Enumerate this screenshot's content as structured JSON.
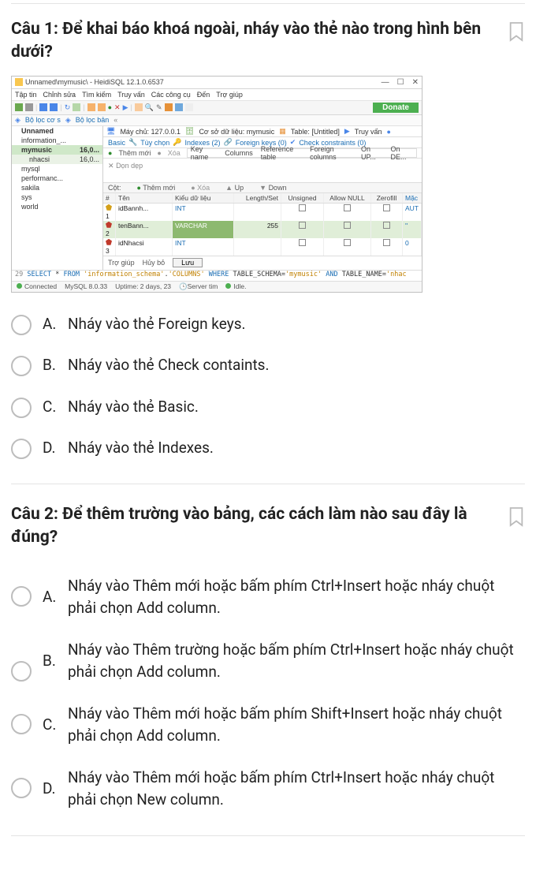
{
  "q1": {
    "number": "Câu 1:",
    "text": "Để khai báo khoá ngoài, nháy vào thẻ nào trong hình bên dưới?",
    "options": {
      "a": {
        "letter": "A.",
        "text": "Nháy vào thẻ Foreign keys."
      },
      "b": {
        "letter": "B.",
        "text": "Nháy vào thẻ Check containts."
      },
      "c": {
        "letter": "C.",
        "text": "Nháy vào thẻ Basic."
      },
      "d": {
        "letter": "D.",
        "text": "Nháy vào thẻ Indexes."
      }
    }
  },
  "q2": {
    "number": "Câu 2:",
    "text": "Để thêm trường vào bảng, các cách làm nào sau đây là đúng?",
    "options": {
      "a": {
        "letter": "A.",
        "text": "Nháy vào Thêm mới hoặc bấm phím Ctrl+Insert hoặc nháy chuột phải chọn Add column."
      },
      "b": {
        "letter": "B.",
        "text": "Nháy vào Thêm trường hoặc bấm phím Ctrl+Insert hoặc nháy chuột phải chọn Add column."
      },
      "c": {
        "letter": "C.",
        "text": "Nháy vào Thêm mới hoặc bấm phím Shift+Insert hoặc nháy chuột phải chọn Add column."
      },
      "d": {
        "letter": "D.",
        "text": "Nháy vào Thêm mới hoặc bấm phím Ctrl+Insert hoặc nháy chuột phải chọn New column."
      }
    }
  },
  "ss": {
    "title": "Unnamed\\mymusic\\ - HeidiSQL 12.1.0.6537",
    "menus": [
      "Tập tin",
      "Chỉnh sửa",
      "Tìm kiếm",
      "Truy vấn",
      "Các công cụ",
      "Đến",
      "Trợ giúp"
    ],
    "donate": "Donate",
    "filter1": "Bộ lọc cơ s",
    "filter2": "Bộ lọc bản",
    "tree": {
      "root": "Unnamed",
      "items": [
        {
          "name": "information_..."
        },
        {
          "name": "mymusic",
          "size": "16,0..."
        },
        {
          "name": "nhacsi",
          "size": "16,0..."
        },
        {
          "name": "mysql"
        },
        {
          "name": "performanc..."
        },
        {
          "name": "sakila"
        },
        {
          "name": "sys"
        },
        {
          "name": "world"
        }
      ]
    },
    "tabs": {
      "host": "Máy chủ: 127.0.0.1",
      "db": "Cơ sở dữ liệu: mymusic",
      "table": "Table: [Untitled]",
      "query": "Truy vấn"
    },
    "subtabs": {
      "basic": "Basic",
      "opts": "Tùy chọn",
      "indexes": "Indexes (2)",
      "fk": "Foreign keys (0)",
      "cc": "Check constraints (0)"
    },
    "fk_actions": {
      "add": "Thêm mới",
      "del": "Xóa",
      "clean": "Dọn dẹp"
    },
    "fk_cols": [
      "Key name",
      "Columns",
      "Reference table",
      "Foreign columns",
      "On UP...",
      "On DE..."
    ],
    "col_section": {
      "label": "Cột:",
      "add": "Thêm mới",
      "del": "Xóa",
      "up": "Up",
      "down": "Down"
    },
    "thead": [
      "#",
      "Tên",
      "Kiểu dữ liệu",
      "Length/Set",
      "Unsigned",
      "Allow NULL",
      "Zerofill",
      "Mặc"
    ],
    "rows": [
      {
        "i": "1",
        "name": "idBannh...",
        "type": "INT",
        "len": "",
        "mac": "AUT"
      },
      {
        "i": "2",
        "name": "tenBann...",
        "type": "VARCHAR",
        "len": "255",
        "mac": "''"
      },
      {
        "i": "3",
        "name": "idNhacsi",
        "type": "INT",
        "len": "",
        "mac": "0"
      }
    ],
    "btns": {
      "help": "Trợ giúp",
      "cancel": "Hủy bỏ",
      "save": "Lưu"
    },
    "sql": {
      "n": "29",
      "kw1": "SELECT",
      "op1": "*",
      "kw2": "FROM",
      "s1": "'information_schema'",
      "op2": ".",
      "s2": "'COLUMNS'",
      "kw3": "WHERE",
      "c1": "TABLE_SCHEMA",
      "eq": "=",
      "v1": "'mymusic'",
      "kw4": "AND",
      "c2": "TABLE_NAME",
      "v2": "'nhac"
    },
    "status": {
      "conn": "Connected",
      "srv": "MySQL 8.0.33",
      "up": "Uptime: 2 days, 23",
      "t": "Server tim",
      "idle": "Idle."
    }
  }
}
